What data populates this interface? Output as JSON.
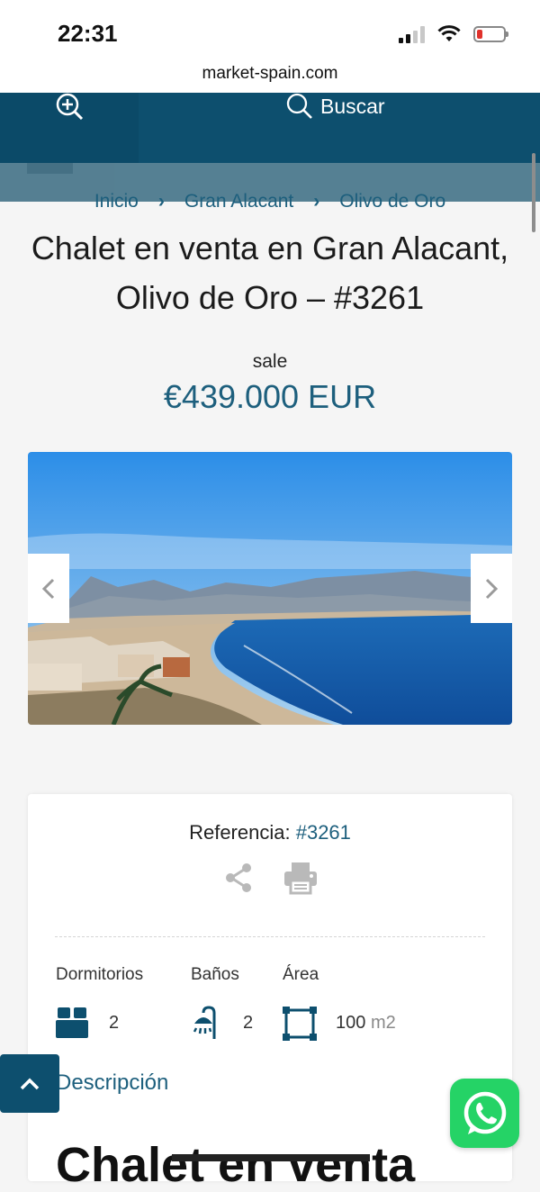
{
  "status_bar": {
    "time": "22:31"
  },
  "browser": {
    "url": "market-spain.com"
  },
  "header": {
    "search_label": "Buscar"
  },
  "breadcrumb": {
    "items": [
      "Inicio",
      "Gran Alacant",
      "Olivo de Oro"
    ]
  },
  "listing": {
    "title": "Chalet en venta en Gran Alacant, Olivo de Oro – #3261",
    "status": "sale",
    "price": "€439.000 EUR"
  },
  "details": {
    "reference_label": "Referencia:",
    "reference_value": "#3261",
    "features": [
      {
        "label": "Dormitorios",
        "value": "2",
        "icon": "bed-icon"
      },
      {
        "label": "Baños",
        "value": "2",
        "icon": "shower-icon"
      },
      {
        "label": "Área",
        "value": "100",
        "unit": "m2",
        "icon": "area-icon"
      }
    ],
    "description_link": "Descripción",
    "description_heading": "Chalet en venta"
  },
  "colors": {
    "brand": "#0d4f6e",
    "link": "#1d5f7d",
    "whatsapp": "#25d366"
  }
}
